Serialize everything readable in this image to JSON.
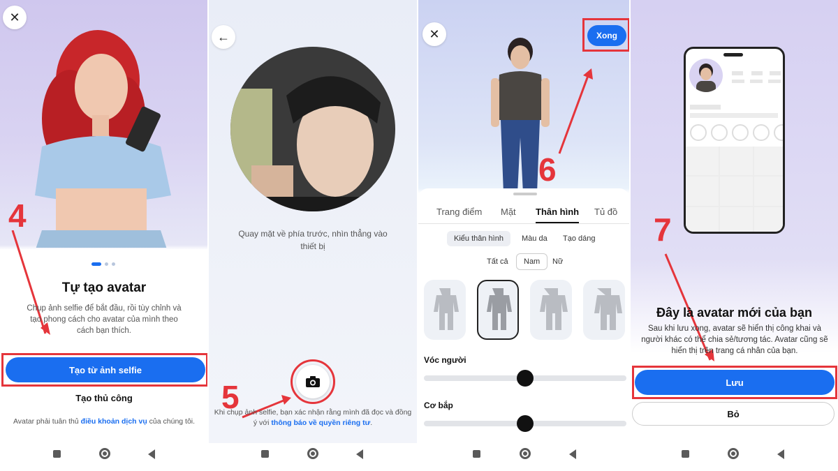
{
  "panel1": {
    "step": "4",
    "title": "Tự tạo avatar",
    "description": "Chụp ảnh selfie để bắt đầu, rồi tùy chỉnh và tạo phong cách cho avatar của mình theo cách bạn thích.",
    "selfie_button": "Tạo từ ảnh selfie",
    "manual_button": "Tạo thủ công",
    "terms_prefix": "Avatar phải tuân thủ ",
    "terms_link": "điều khoản dịch vụ",
    "terms_suffix": " của chúng tôi."
  },
  "panel2": {
    "step": "5",
    "instruction": "Quay mặt về phía trước, nhìn thẳng vào thiết bị",
    "consent_prefix": "Khi chụp ảnh selfie, bạn xác nhận rằng mình đã đọc và đồng ý với ",
    "consent_link": "thông báo về quyền riêng tư",
    "consent_suffix": "."
  },
  "panel3": {
    "step": "6",
    "done_button": "Xong",
    "tabs": [
      "Trang điểm",
      "Mặt",
      "Thân hình",
      "Tủ đồ"
    ],
    "subtabs": [
      "Kiểu thân hình",
      "Màu da",
      "Tạo dáng"
    ],
    "filters": [
      "Tất cả",
      "Nam",
      "Nữ"
    ],
    "slider1_label": "Vóc người",
    "slider1_value": 0.5,
    "slider2_label": "Cơ bắp",
    "slider2_value": 0.5
  },
  "panel4": {
    "step": "7",
    "title": "Đây là avatar mới của bạn",
    "description": "Sau khi lưu xong, avatar sẽ hiển thị công khai và người khác có thể chia sẻ/tương tác. Avatar cũng sẽ hiển thị trên trang cá nhân của bạn.",
    "save_button": "Lưu",
    "skip_button": "Bỏ"
  },
  "icons": {
    "close": "close-icon",
    "back": "arrow-left-icon",
    "camera": "camera-icon"
  },
  "colors": {
    "accent": "#1a6ef0",
    "highlight": "#e5353b"
  }
}
